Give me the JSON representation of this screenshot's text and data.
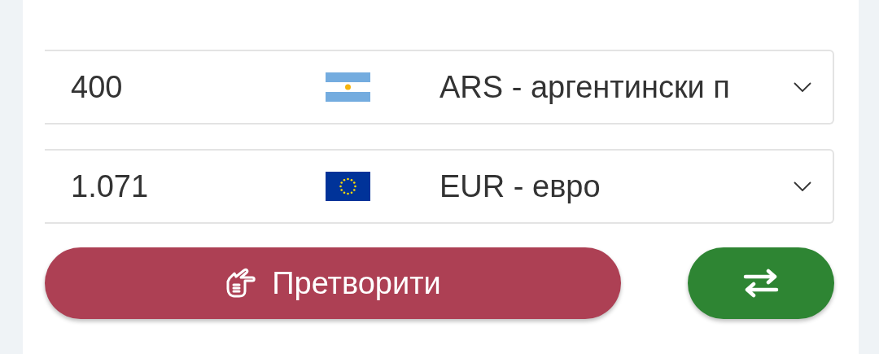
{
  "converter": {
    "rows": [
      {
        "amount": "400",
        "flag": {
          "kind": "argentina"
        },
        "currency": "ARS - аргентински п"
      },
      {
        "amount": "1.071",
        "flag": {
          "kind": "europe"
        },
        "currency": "EUR - евро"
      }
    ],
    "convert_button": {
      "label": "Претворити"
    }
  }
}
